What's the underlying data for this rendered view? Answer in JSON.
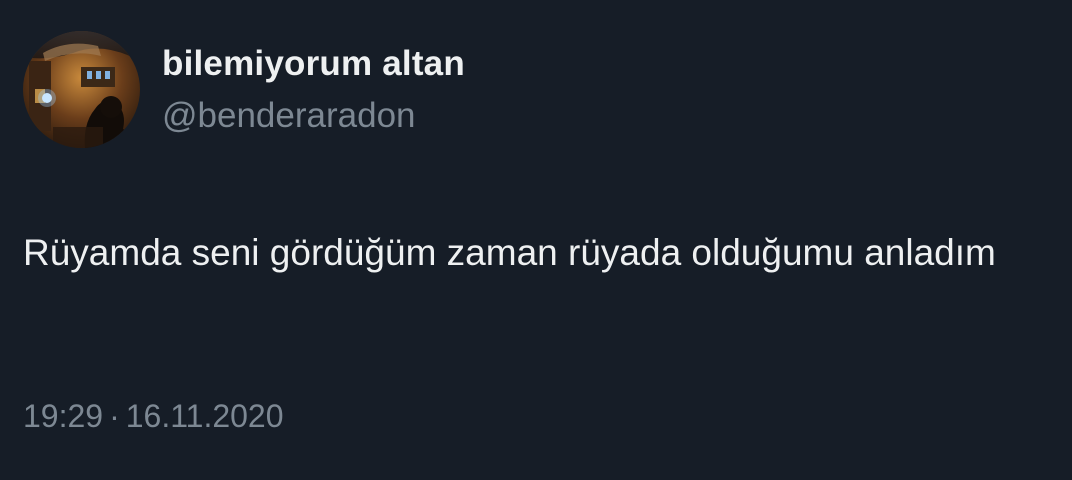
{
  "author": {
    "display_name": "bilemiyorum altan",
    "handle": "@benderaradon",
    "avatar": "profile-photo"
  },
  "tweet": {
    "text": "Rüyamda seni gördüğüm zaman rüyada olduğumu anladım",
    "time": "19:29",
    "separator": "·",
    "date": "16.11.2020"
  },
  "colors": {
    "background": "#161d27",
    "text": "#eef0f1",
    "secondary_text": "#7d8893"
  }
}
